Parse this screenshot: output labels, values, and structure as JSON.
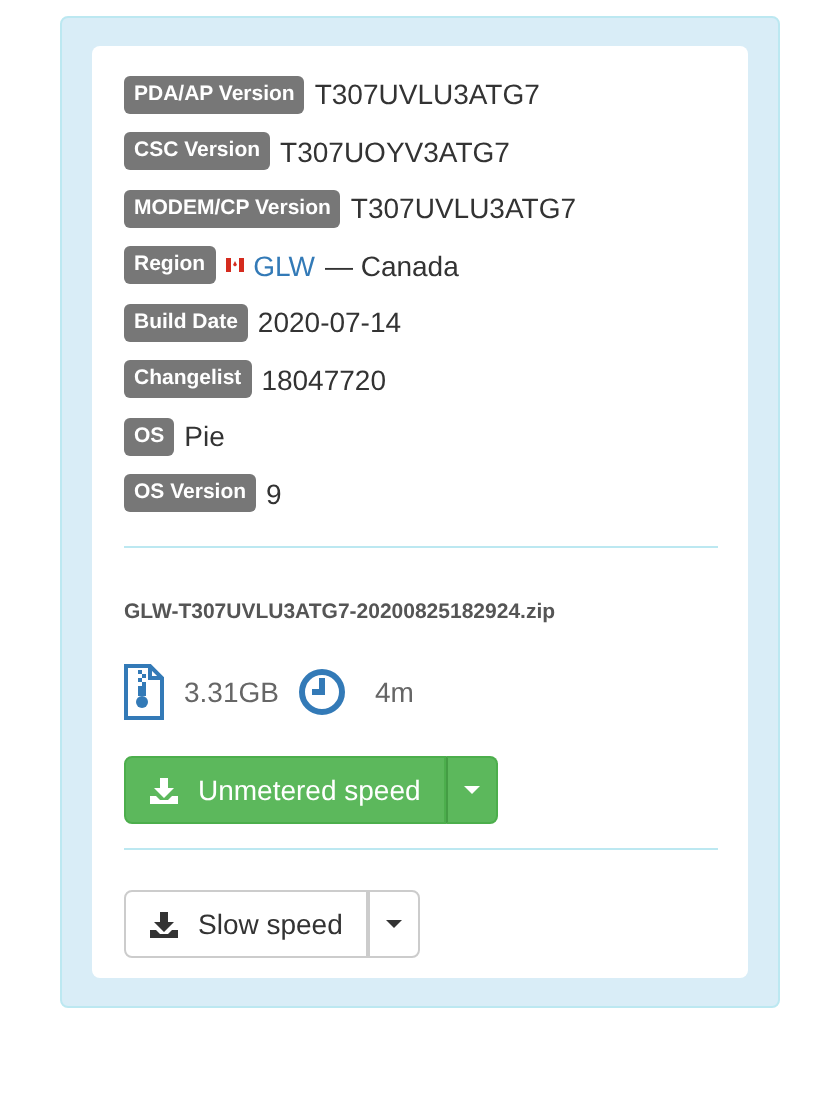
{
  "details": [
    {
      "kind": "text",
      "label": "PDA/AP Version",
      "value": "T307UVLU3ATG7"
    },
    {
      "kind": "text",
      "label": "CSC Version",
      "value": "T307UOYV3ATG7"
    },
    {
      "kind": "text",
      "label": "MODEM/CP Version",
      "value": "T307UVLU3ATG7"
    },
    {
      "kind": "region",
      "label": "Region",
      "link": "GLW",
      "value": "— Canada"
    },
    {
      "kind": "text",
      "label": "Build Date",
      "value": "2020-07-14"
    },
    {
      "kind": "text",
      "label": "Changelist",
      "value": "18047720"
    },
    {
      "kind": "text",
      "label": "OS",
      "value": "Pie"
    },
    {
      "kind": "text",
      "label": "OS Version",
      "value": "9"
    }
  ],
  "file": {
    "name": "GLW-T307UVLU3ATG7-20200825182924.zip",
    "size": "3.31GB",
    "time": "4m"
  },
  "downloads": [
    {
      "kind": "primary",
      "label": "Unmetered speed"
    },
    {
      "kind": "default",
      "label": "Slow speed"
    }
  ]
}
